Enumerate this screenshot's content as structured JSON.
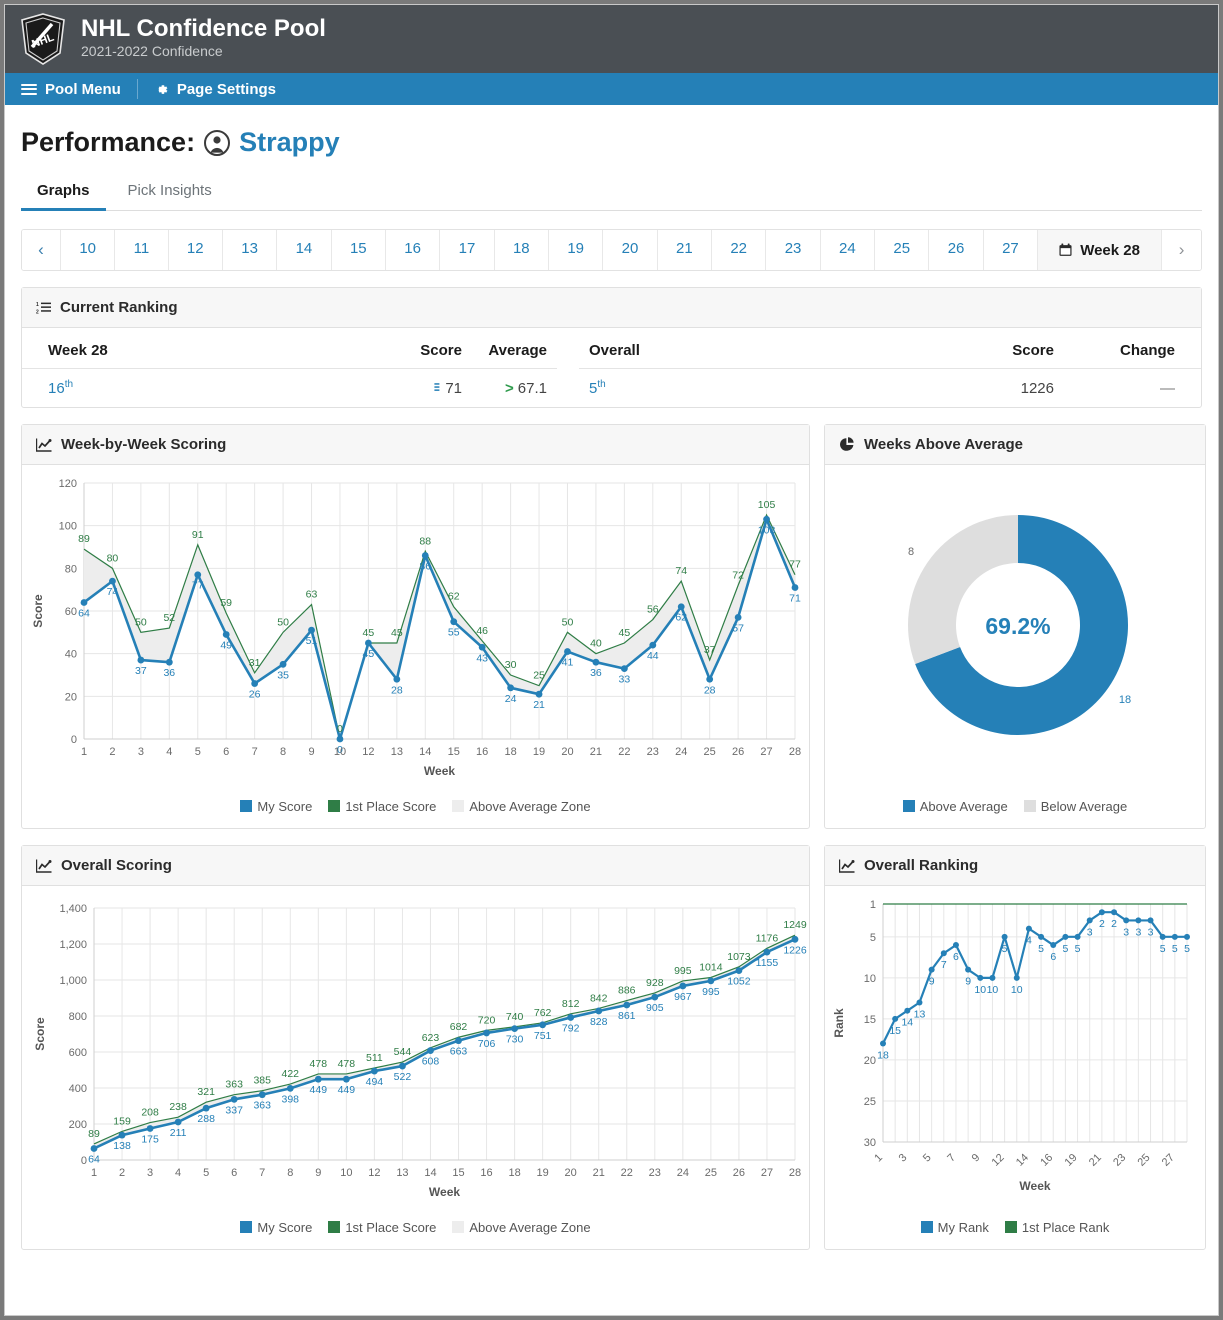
{
  "masthead": {
    "title": "NHL Confidence Pool",
    "subtitle": "2021-2022 Confidence",
    "logo_text": "NHL"
  },
  "navbar": {
    "pool_menu": "Pool Menu",
    "page_settings": "Page Settings"
  },
  "page": {
    "title_prefix": "Performance:",
    "user": "Strappy"
  },
  "tabs": [
    {
      "label": "Graphs",
      "active": true
    },
    {
      "label": "Pick Insights",
      "active": false
    }
  ],
  "pager": {
    "prev": "‹",
    "next": "›",
    "weeks": [
      "10",
      "11",
      "12",
      "13",
      "14",
      "15",
      "16",
      "17",
      "18",
      "19",
      "20",
      "21",
      "22",
      "23",
      "24",
      "25",
      "26",
      "27"
    ],
    "active_label": "Week 28"
  },
  "ranking": {
    "card_title": "Current Ranking",
    "headers": {
      "week": "Week 28",
      "score": "Score",
      "average": "Average",
      "overall": "Overall",
      "overall_score": "Score",
      "change": "Change"
    },
    "row": {
      "week_rank": "16",
      "week_rank_sup": "th",
      "week_score": "71",
      "week_average": "67.1",
      "overall_rank": "5",
      "overall_rank_sup": "th",
      "overall_score": "1226",
      "change": "—"
    }
  },
  "panels": {
    "week_scoring": "Week-by-Week Scoring",
    "weeks_above_average": "Weeks Above Average",
    "overall_scoring": "Overall Scoring",
    "overall_ranking": "Overall Ranking"
  },
  "legends": {
    "score": [
      {
        "label": "My Score",
        "color": "#2580b7"
      },
      {
        "label": "1st Place Score",
        "color": "#2f7d46"
      },
      {
        "label": "Above Average Zone",
        "color": "#ededed"
      }
    ],
    "donut": [
      {
        "label": "Above Average",
        "color": "#2580b7"
      },
      {
        "label": "Below Average",
        "color": "#dedede"
      }
    ],
    "rank": [
      {
        "label": "My Rank",
        "color": "#2580b7"
      },
      {
        "label": "1st Place Rank",
        "color": "#2f7d46"
      }
    ]
  },
  "chart_data": [
    {
      "type": "line",
      "title": "Week-by-Week Scoring",
      "xlabel": "Week",
      "ylabel": "Score",
      "ylim": [
        0,
        120
      ],
      "yticks": [
        0,
        20,
        40,
        60,
        80,
        100,
        120
      ],
      "grid": true,
      "categories": [
        "1",
        "2",
        "3",
        "4",
        "5",
        "6",
        "7",
        "8",
        "9",
        "10",
        "12",
        "13",
        "14",
        "15",
        "16",
        "18",
        "19",
        "20",
        "21",
        "22",
        "23",
        "24",
        "25",
        "26",
        "27",
        "28"
      ],
      "series": [
        {
          "name": "My Score",
          "color": "#2580b7",
          "values": [
            64,
            74,
            37,
            36,
            77,
            49,
            26,
            35,
            51,
            0,
            45,
            28,
            86,
            55,
            43,
            24,
            21,
            41,
            36,
            33,
            44,
            62,
            28,
            57,
            103,
            71
          ]
        },
        {
          "name": "1st Place Score",
          "color": "#2f7d46",
          "values": [
            89,
            80,
            50,
            52,
            91,
            59,
            31,
            50,
            63,
            0,
            45,
            45,
            88,
            62,
            46,
            30,
            25,
            50,
            40,
            45,
            56,
            74,
            37,
            72,
            105,
            77
          ]
        }
      ],
      "shaded_band": "Above Average Zone"
    },
    {
      "type": "pie",
      "title": "Weeks Above Average",
      "center_label": "69.2%",
      "labels": [
        "Above Average",
        "Below Average"
      ],
      "values": [
        18,
        8
      ],
      "colors": [
        "#2580b7",
        "#dedede"
      ],
      "legend_position": "bottom",
      "donut": true
    },
    {
      "type": "line",
      "title": "Overall Scoring",
      "xlabel": "Week",
      "ylabel": "Score",
      "ylim": [
        0,
        1400
      ],
      "yticks": [
        0,
        200,
        400,
        600,
        800,
        1000,
        1200,
        1400
      ],
      "ytick_labels": [
        "0",
        "200",
        "400",
        "600",
        "800",
        "1,000",
        "1,200",
        "1,400"
      ],
      "grid": true,
      "categories": [
        "1",
        "2",
        "3",
        "4",
        "5",
        "6",
        "7",
        "8",
        "9",
        "10",
        "12",
        "13",
        "14",
        "15",
        "16",
        "18",
        "19",
        "20",
        "21",
        "22",
        "23",
        "24",
        "25",
        "26",
        "27",
        "28"
      ],
      "series": [
        {
          "name": "My Score",
          "color": "#2580b7",
          "values": [
            64,
            138,
            175,
            211,
            288,
            337,
            363,
            398,
            449,
            449,
            494,
            522,
            608,
            663,
            706,
            730,
            751,
            792,
            828,
            861,
            905,
            967,
            995,
            1052,
            1155,
            1226
          ]
        },
        {
          "name": "1st Place Score",
          "color": "#2f7d46",
          "values": [
            89,
            159,
            208,
            238,
            321,
            363,
            385,
            422,
            478,
            478,
            511,
            544,
            623,
            682,
            720,
            740,
            762,
            812,
            842,
            886,
            928,
            995,
            1014,
            1073,
            1176,
            1249
          ]
        }
      ],
      "shaded_band": "Above Average Zone"
    },
    {
      "type": "line",
      "title": "Overall Ranking",
      "xlabel": "Week",
      "ylabel": "Rank",
      "ylim": [
        1,
        30
      ],
      "yticks": [
        1,
        5,
        10,
        15,
        20,
        25,
        30
      ],
      "y_inverted": true,
      "grid": true,
      "categories": [
        "1",
        "2",
        "3",
        "4",
        "5",
        "6",
        "7",
        "8",
        "9",
        "10",
        "12",
        "13",
        "14",
        "15",
        "16",
        "18",
        "19",
        "20",
        "21",
        "22",
        "23",
        "24",
        "25",
        "26",
        "27",
        "28"
      ],
      "xtick_labels": [
        "1",
        "3",
        "5",
        "7",
        "9",
        "12",
        "14",
        "16",
        "19",
        "21",
        "23",
        "25",
        "27"
      ],
      "series": [
        {
          "name": "My Rank",
          "color": "#2580b7",
          "values": [
            18,
            15,
            14,
            13,
            9,
            7,
            6,
            9,
            10,
            10,
            5,
            10,
            4,
            5,
            6,
            5,
            5,
            3,
            2,
            2,
            3,
            3,
            3,
            5,
            5,
            5
          ]
        },
        {
          "name": "1st Place Rank",
          "color": "#2f7d46",
          "values": [
            1,
            1,
            1,
            1,
            1,
            1,
            1,
            1,
            1,
            1,
            1,
            1,
            1,
            1,
            1,
            1,
            1,
            1,
            1,
            1,
            1,
            1,
            1,
            1,
            1,
            1
          ]
        }
      ]
    }
  ]
}
